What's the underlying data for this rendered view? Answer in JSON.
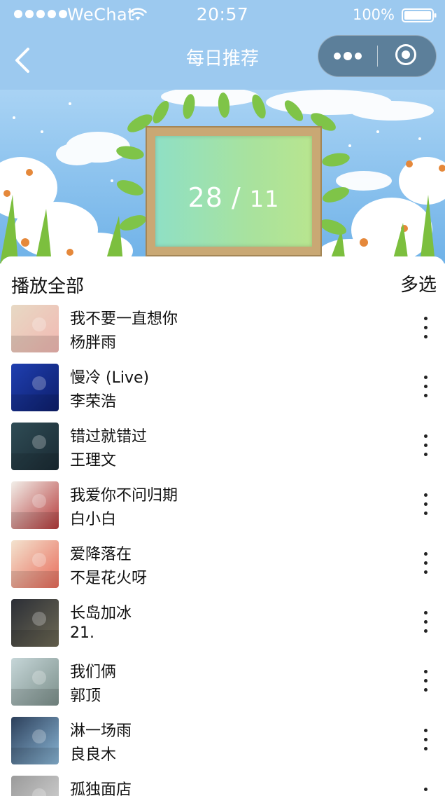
{
  "status_bar": {
    "carrier": "WeChat",
    "time": "20:57",
    "battery": "100%"
  },
  "nav": {
    "title": "每日推荐",
    "back_icon": "chevron-left-icon",
    "more_icon": "more-dots-icon",
    "close_icon": "target-circle-icon"
  },
  "banner": {
    "day": "28",
    "separator": "/",
    "month": "11"
  },
  "list_header": {
    "play_all": "播放全部",
    "multi_select": "多选"
  },
  "songs": [
    {
      "title": "我不要一直想你",
      "artist": "杨胖雨",
      "cover_colors": [
        "#e7d9c4",
        "#f2b8b2"
      ]
    },
    {
      "title": "慢冷 (Live)",
      "artist": "李荣浩",
      "cover_colors": [
        "#1f3fb0",
        "#0d1e6b"
      ]
    },
    {
      "title": "错过就错过",
      "artist": "王理文",
      "cover_colors": [
        "#2f4c55",
        "#1a2a33"
      ]
    },
    {
      "title": "我爱你不问归期",
      "artist": "白小白",
      "cover_colors": [
        "#f2efe9",
        "#b53a3a"
      ]
    },
    {
      "title": "爱降落在",
      "artist": "不是花火呀",
      "cover_colors": [
        "#f3e3cf",
        "#e86b5a"
      ]
    },
    {
      "title": "长岛加冰",
      "artist": "21.",
      "cover_colors": [
        "#2b2e36",
        "#6e6a55"
      ]
    },
    {
      "title": "我们俩",
      "artist": "郭顶",
      "cover_colors": [
        "#c6d6d8",
        "#7b8f8a"
      ]
    },
    {
      "title": "淋一场雨",
      "artist": "良良木",
      "cover_colors": [
        "#2c3f5a",
        "#8ab6d6"
      ]
    },
    {
      "title": "孤独面店",
      "artist": "",
      "cover_colors": [
        "#9a9a9a",
        "#d8d8d8"
      ]
    }
  ]
}
